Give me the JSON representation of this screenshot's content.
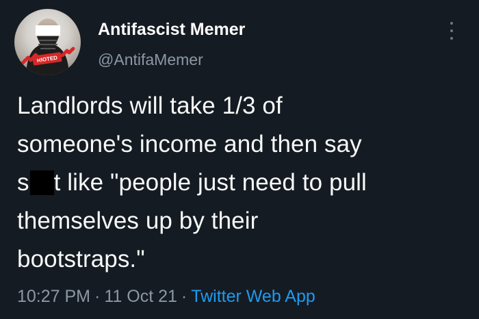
{
  "tweet": {
    "display_name": "Antifascist Memer",
    "handle": "@AntifaMemer",
    "text_lines": [
      "Landlords will take 1/3 of",
      "someone's income and then say",
      "s",
      "t like \"people just need to pull",
      "themselves up by their",
      "bootstraps.\""
    ],
    "time": "10:27 PM",
    "separator": "·",
    "date": "11 Oct 21",
    "source": "Twitter Web App"
  },
  "avatar": {
    "badge_text": "RIOTED"
  },
  "icons": {
    "more": "more-vertical-icon"
  }
}
